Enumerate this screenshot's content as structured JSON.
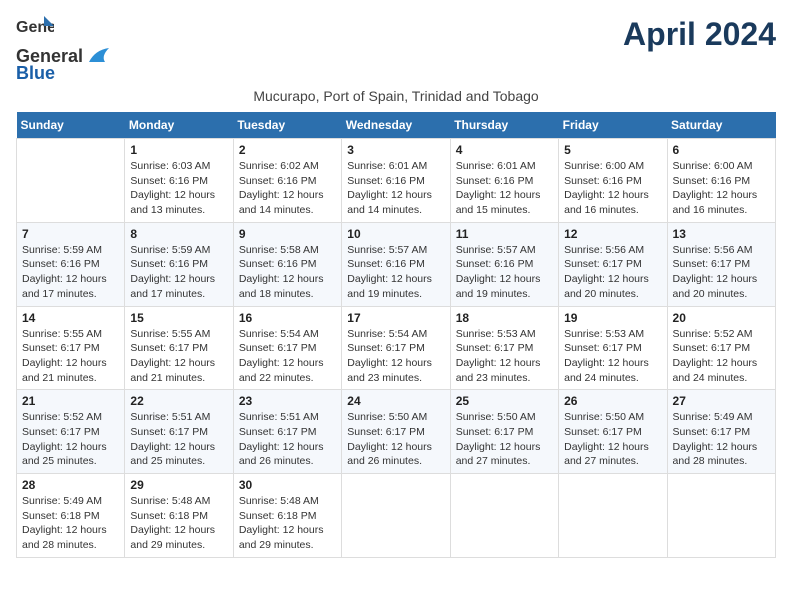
{
  "header": {
    "logo_general": "General",
    "logo_blue": "Blue",
    "month_title": "April 2024",
    "subtitle": "Mucurapo, Port of Spain, Trinidad and Tobago"
  },
  "calendar": {
    "days_of_week": [
      "Sunday",
      "Monday",
      "Tuesday",
      "Wednesday",
      "Thursday",
      "Friday",
      "Saturday"
    ],
    "weeks": [
      [
        {
          "num": "",
          "info": ""
        },
        {
          "num": "1",
          "info": "Sunrise: 6:03 AM\nSunset: 6:16 PM\nDaylight: 12 hours\nand 13 minutes."
        },
        {
          "num": "2",
          "info": "Sunrise: 6:02 AM\nSunset: 6:16 PM\nDaylight: 12 hours\nand 14 minutes."
        },
        {
          "num": "3",
          "info": "Sunrise: 6:01 AM\nSunset: 6:16 PM\nDaylight: 12 hours\nand 14 minutes."
        },
        {
          "num": "4",
          "info": "Sunrise: 6:01 AM\nSunset: 6:16 PM\nDaylight: 12 hours\nand 15 minutes."
        },
        {
          "num": "5",
          "info": "Sunrise: 6:00 AM\nSunset: 6:16 PM\nDaylight: 12 hours\nand 16 minutes."
        },
        {
          "num": "6",
          "info": "Sunrise: 6:00 AM\nSunset: 6:16 PM\nDaylight: 12 hours\nand 16 minutes."
        }
      ],
      [
        {
          "num": "7",
          "info": "Sunrise: 5:59 AM\nSunset: 6:16 PM\nDaylight: 12 hours\nand 17 minutes."
        },
        {
          "num": "8",
          "info": "Sunrise: 5:59 AM\nSunset: 6:16 PM\nDaylight: 12 hours\nand 17 minutes."
        },
        {
          "num": "9",
          "info": "Sunrise: 5:58 AM\nSunset: 6:16 PM\nDaylight: 12 hours\nand 18 minutes."
        },
        {
          "num": "10",
          "info": "Sunrise: 5:57 AM\nSunset: 6:16 PM\nDaylight: 12 hours\nand 19 minutes."
        },
        {
          "num": "11",
          "info": "Sunrise: 5:57 AM\nSunset: 6:16 PM\nDaylight: 12 hours\nand 19 minutes."
        },
        {
          "num": "12",
          "info": "Sunrise: 5:56 AM\nSunset: 6:17 PM\nDaylight: 12 hours\nand 20 minutes."
        },
        {
          "num": "13",
          "info": "Sunrise: 5:56 AM\nSunset: 6:17 PM\nDaylight: 12 hours\nand 20 minutes."
        }
      ],
      [
        {
          "num": "14",
          "info": "Sunrise: 5:55 AM\nSunset: 6:17 PM\nDaylight: 12 hours\nand 21 minutes."
        },
        {
          "num": "15",
          "info": "Sunrise: 5:55 AM\nSunset: 6:17 PM\nDaylight: 12 hours\nand 21 minutes."
        },
        {
          "num": "16",
          "info": "Sunrise: 5:54 AM\nSunset: 6:17 PM\nDaylight: 12 hours\nand 22 minutes."
        },
        {
          "num": "17",
          "info": "Sunrise: 5:54 AM\nSunset: 6:17 PM\nDaylight: 12 hours\nand 23 minutes."
        },
        {
          "num": "18",
          "info": "Sunrise: 5:53 AM\nSunset: 6:17 PM\nDaylight: 12 hours\nand 23 minutes."
        },
        {
          "num": "19",
          "info": "Sunrise: 5:53 AM\nSunset: 6:17 PM\nDaylight: 12 hours\nand 24 minutes."
        },
        {
          "num": "20",
          "info": "Sunrise: 5:52 AM\nSunset: 6:17 PM\nDaylight: 12 hours\nand 24 minutes."
        }
      ],
      [
        {
          "num": "21",
          "info": "Sunrise: 5:52 AM\nSunset: 6:17 PM\nDaylight: 12 hours\nand 25 minutes."
        },
        {
          "num": "22",
          "info": "Sunrise: 5:51 AM\nSunset: 6:17 PM\nDaylight: 12 hours\nand 25 minutes."
        },
        {
          "num": "23",
          "info": "Sunrise: 5:51 AM\nSunset: 6:17 PM\nDaylight: 12 hours\nand 26 minutes."
        },
        {
          "num": "24",
          "info": "Sunrise: 5:50 AM\nSunset: 6:17 PM\nDaylight: 12 hours\nand 26 minutes."
        },
        {
          "num": "25",
          "info": "Sunrise: 5:50 AM\nSunset: 6:17 PM\nDaylight: 12 hours\nand 27 minutes."
        },
        {
          "num": "26",
          "info": "Sunrise: 5:50 AM\nSunset: 6:17 PM\nDaylight: 12 hours\nand 27 minutes."
        },
        {
          "num": "27",
          "info": "Sunrise: 5:49 AM\nSunset: 6:17 PM\nDaylight: 12 hours\nand 28 minutes."
        }
      ],
      [
        {
          "num": "28",
          "info": "Sunrise: 5:49 AM\nSunset: 6:18 PM\nDaylight: 12 hours\nand 28 minutes."
        },
        {
          "num": "29",
          "info": "Sunrise: 5:48 AM\nSunset: 6:18 PM\nDaylight: 12 hours\nand 29 minutes."
        },
        {
          "num": "30",
          "info": "Sunrise: 5:48 AM\nSunset: 6:18 PM\nDaylight: 12 hours\nand 29 minutes."
        },
        {
          "num": "",
          "info": ""
        },
        {
          "num": "",
          "info": ""
        },
        {
          "num": "",
          "info": ""
        },
        {
          "num": "",
          "info": ""
        }
      ]
    ]
  }
}
